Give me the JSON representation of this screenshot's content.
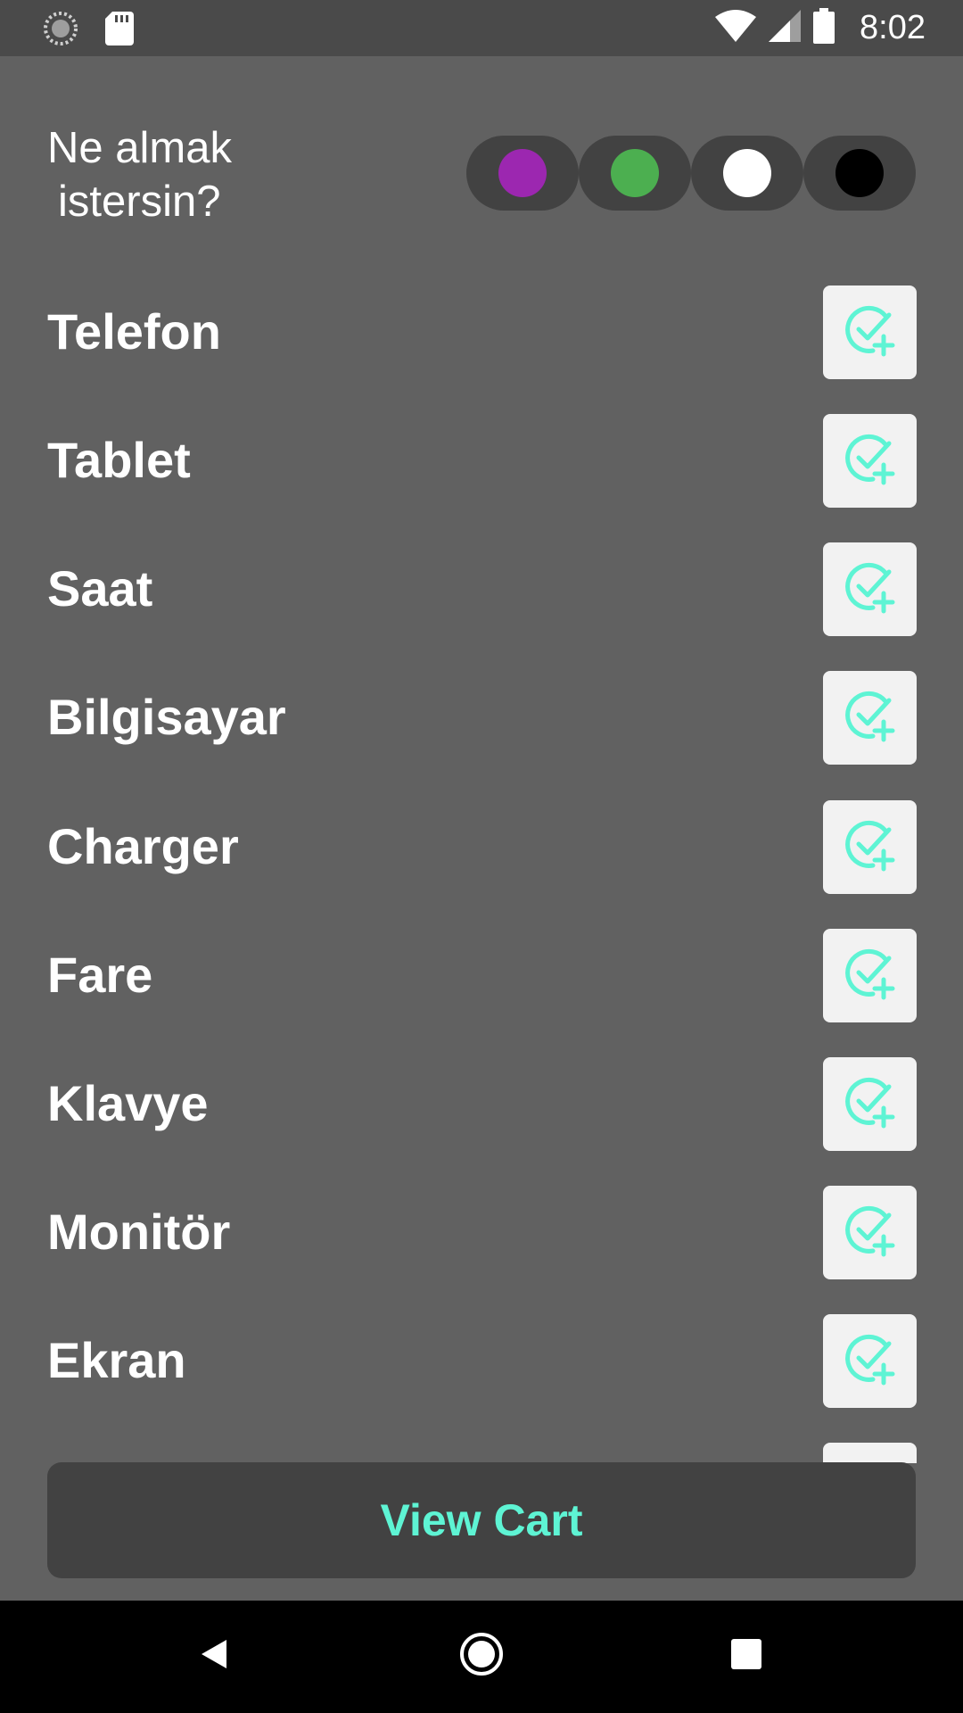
{
  "status_bar": {
    "time": "8:02",
    "icons": [
      "loading-icon",
      "sd-card-icon",
      "wifi-icon",
      "signal-icon",
      "battery-icon"
    ]
  },
  "header": {
    "line1": "Ne almak",
    "line2": "istersin?"
  },
  "color_options": [
    {
      "name": "purple",
      "color": "#9c27b0"
    },
    {
      "name": "green",
      "color": "#4caf50"
    },
    {
      "name": "white",
      "color": "#ffffff"
    },
    {
      "name": "black",
      "color": "#000000"
    }
  ],
  "products": [
    {
      "label": "Telefon"
    },
    {
      "label": "Tablet"
    },
    {
      "label": "Saat"
    },
    {
      "label": "Bilgisayar"
    },
    {
      "label": "Charger"
    },
    {
      "label": "Fare"
    },
    {
      "label": "Klavye"
    },
    {
      "label": "Monitör"
    },
    {
      "label": "Ekran"
    }
  ],
  "add_icon_name": "check-plus-icon",
  "view_cart": {
    "label": "View Cart"
  },
  "navigation": {
    "back_icon": "back-icon",
    "home_icon": "home-icon",
    "recents_icon": "recents-icon"
  },
  "colors": {
    "background": "#616161",
    "accent": "#5ef4d4",
    "button_bg": "#424242"
  }
}
